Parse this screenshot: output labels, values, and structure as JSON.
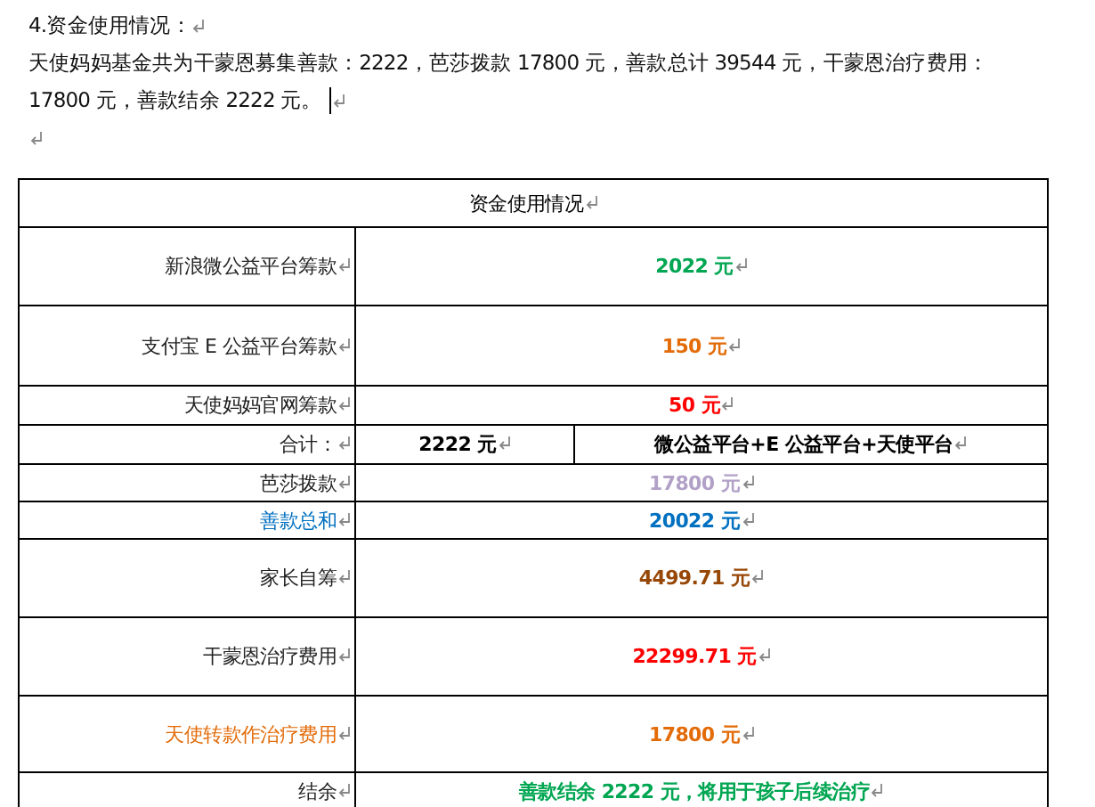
{
  "heading": "4.资金使用情况：",
  "paragraph": [
    "天使妈妈基金共为干蒙恩募集善款：2222，芭莎拨款 17800 元，善款总计 39544 元，干蒙恩治疗费用：",
    "17800 元，善款结余 2222 元。"
  ],
  "table": {
    "title": "资金使用情况",
    "rows": [
      {
        "label": "新浪微公益平台筹款",
        "color": "#222222",
        "values": [
          {
            "text": "2022 元",
            "color": "#00a651"
          }
        ]
      },
      {
        "label": "支付宝 E 公益平台筹款",
        "color": "#222222",
        "values": [
          {
            "text": "150 元",
            "color": "#e36c09"
          }
        ]
      },
      {
        "label": "天使妈妈官网筹款",
        "color": "#222222",
        "values": [
          {
            "text": "50 元",
            "color": "#ff0000"
          }
        ]
      },
      {
        "label": "合计：",
        "color": "#222222",
        "values": [
          {
            "text": "2222 元",
            "color": "#000000"
          },
          {
            "text": "微公益平台+E 公益平台+天使平台",
            "color": "#000000"
          }
        ]
      },
      {
        "label": "芭莎拨款",
        "color": "#222222",
        "values": [
          {
            "text": "17800 元",
            "color": "#b2a1c7"
          }
        ]
      },
      {
        "label": "善款总和",
        "color": "#0070c0",
        "values": [
          {
            "text": "20022 元",
            "color": "#0070c0"
          }
        ]
      },
      {
        "label": "家长自筹",
        "color": "#222222",
        "values": [
          {
            "text": "4499.71 元",
            "color": "#974706"
          }
        ]
      },
      {
        "label": "干蒙恩治疗费用",
        "color": "#222222",
        "values": [
          {
            "text": "22299.71 元",
            "color": "#ff0000"
          }
        ]
      },
      {
        "label": "天使转款作治疗费用",
        "color": "#e36c09",
        "values": [
          {
            "text": "17800 元",
            "color": "#e36c09"
          }
        ]
      },
      {
        "label": "结余",
        "color": "#222222",
        "values": [
          {
            "text": "善款结余 2222 元，将用于孩子后续治疗",
            "color": "#00a651"
          }
        ]
      }
    ]
  }
}
